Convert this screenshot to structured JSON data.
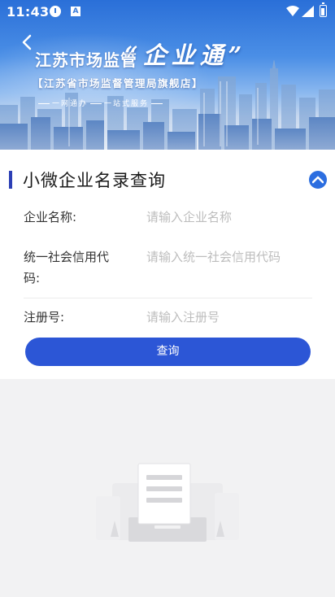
{
  "status_bar": {
    "time": "11:43"
  },
  "hero": {
    "title_prefix": "江苏市场监管",
    "title_emphasis": "“企业通”",
    "subtitle": "【江苏省市场监督管理局旗舰店】",
    "slogan_left": "一网通办",
    "slogan_right": "一站式服务"
  },
  "card": {
    "title": "小微企业名录查询",
    "fields": [
      {
        "label": "企业名称:",
        "placeholder": "请输入企业名称"
      },
      {
        "label_line1": "统一社会信用代",
        "label_line2": "码:",
        "placeholder": "请输入统一社会信用代码"
      },
      {
        "label": "注册号:",
        "placeholder": "请输入注册号"
      }
    ],
    "query_button": "查询"
  },
  "colors": {
    "accent": "#2c56d6",
    "title_bar": "#2c3fb5",
    "collapse": "#2c6ee0",
    "background": "#f2f2f3"
  },
  "icons": {
    "back": "chevron-left-icon",
    "collapse": "chevron-up-icon",
    "empty": "empty-document-illustration"
  }
}
